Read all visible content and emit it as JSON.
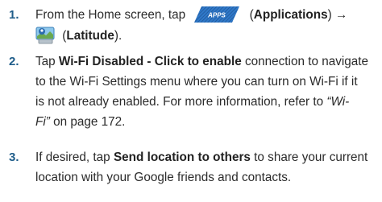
{
  "steps": [
    {
      "number": "1.",
      "line1_prefix": "From the Home screen, tap ",
      "apps_button": "APPS",
      "line1_open": " (",
      "applications": "Applications",
      "line1_close": ") →",
      "line2_open": " (",
      "latitude": "Latitude",
      "line2_close": ")."
    },
    {
      "number": "2.",
      "prefix": "Tap ",
      "bold": "Wi-Fi Disabled - Click to enable",
      "line1_suffix": " connection to navigate",
      "line2": "to the Wi-Fi Settings menu where you can turn on Wi-Fi if it",
      "line3_prefix": "is not already enabled. For more information, refer to ",
      "line3_italic": "“Wi-",
      "line4_italic": "Fi”",
      "line4_suffix": " on page 172."
    },
    {
      "number": "3.",
      "prefix": "If desired, tap ",
      "bold": "Send location to others",
      "line1_suffix": " to share your current",
      "line2": "location with your Google friends and contacts."
    }
  ],
  "colors": {
    "step_number": "#1f5d8a",
    "apps_button": "#2a6db8",
    "text": "#2b2b2b"
  },
  "icons": {
    "apps_button": "apps-button-icon",
    "latitude": "latitude-app-icon"
  }
}
